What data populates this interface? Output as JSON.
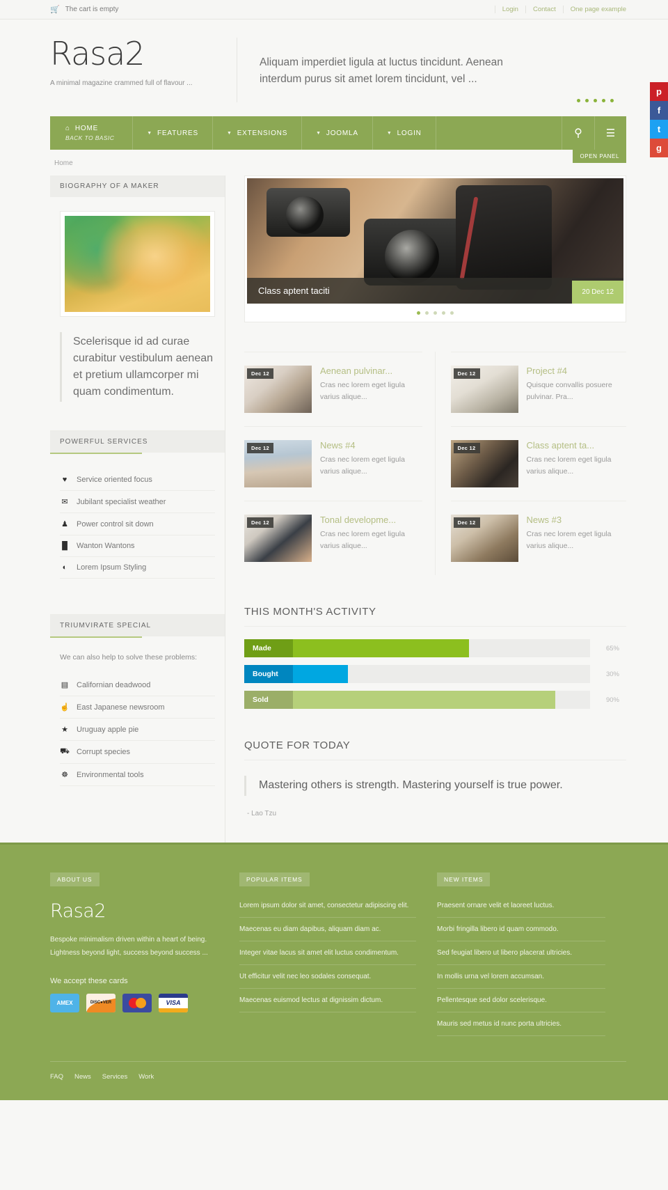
{
  "topbar": {
    "cart_icon": "cart-icon",
    "cart_text": "The cart is empty",
    "links": [
      "Login",
      "Contact",
      "One page example"
    ]
  },
  "header": {
    "brand": "Rasa2",
    "tagline": "A minimal magazine crammed full of flavour ...",
    "promo": "Aliquam imperdiet ligula at luctus tincidunt. Aenean interdum purus sit amet lorem tincidunt, vel ...",
    "promo_dots": 5
  },
  "nav": {
    "items": [
      {
        "label": "HOME",
        "sub": "BACK TO BASIC",
        "icon": "home-icon",
        "caret": false
      },
      {
        "label": "FEATURES",
        "sub": "",
        "icon": "",
        "caret": true
      },
      {
        "label": "EXTENSIONS",
        "sub": "",
        "icon": "",
        "caret": true
      },
      {
        "label": "JOOMLA",
        "sub": "",
        "icon": "",
        "caret": true
      },
      {
        "label": "LOGIN",
        "sub": "",
        "icon": "",
        "caret": true
      }
    ],
    "search_icon": "search-icon",
    "menu_icon": "hamburger-icon",
    "open_panel": "OPEN PANEL"
  },
  "breadcrumb": "Home",
  "sidebar": {
    "biography": {
      "title": "BIOGRAPHY OF A MAKER",
      "image_name": "portrait-photo",
      "quote": "Scelerisque id ad curae curabitur vestibulum aenean et pretium ullamcorper mi quam condimentum."
    },
    "services": {
      "title": "POWERFUL SERVICES",
      "items": [
        {
          "icon": "heart-icon",
          "glyph": "♥",
          "label": "Service oriented focus"
        },
        {
          "icon": "envelope-icon",
          "glyph": "✉",
          "label": "Jubilant specialist weather"
        },
        {
          "icon": "user-icon",
          "glyph": "♟",
          "label": "Power control sit down"
        },
        {
          "icon": "bar-chart-icon",
          "glyph": "█",
          "label": "Wanton Wantons"
        },
        {
          "icon": "contrast-icon",
          "glyph": "◐",
          "label": "Lorem Ipsum Styling"
        }
      ]
    },
    "triumvirate": {
      "title": "TRIUMVIRATE SPECIAL",
      "note": "We can also help to solve these problems:",
      "items": [
        {
          "icon": "film-icon",
          "glyph": "▤",
          "label": "Californian deadwood"
        },
        {
          "icon": "thumbs-up-icon",
          "glyph": "☝",
          "label": "East Japanese newsroom"
        },
        {
          "icon": "star-icon",
          "glyph": "★",
          "label": "Uruguay apple pie"
        },
        {
          "icon": "car-icon",
          "glyph": "⛟",
          "label": "Corrupt species"
        },
        {
          "icon": "globe-icon",
          "glyph": "☸",
          "label": "Environmental tools"
        }
      ]
    }
  },
  "slider": {
    "image_name": "vintage-cameras-photo",
    "caption": "Class aptent taciti",
    "date": "20 Dec 12",
    "dots": 5,
    "active_dot": 0
  },
  "articles": {
    "left": [
      {
        "badge": "Dec 12",
        "title": "Aenean pulvinar...",
        "desc": "Cras nec lorem eget ligula varius alique...",
        "thumb": "t-desk",
        "thumb_name": "desk-speaker-photo"
      },
      {
        "badge": "Dec 12",
        "title": "News #4",
        "desc": "Cras nec lorem eget ligula varius alique...",
        "thumb": "t-beach",
        "thumb_name": "beach-woman-photo"
      },
      {
        "badge": "Dec 12",
        "title": "Tonal developme...",
        "desc": "Cras nec lorem eget ligula varius alique...",
        "thumb": "t-office",
        "thumb_name": "office-desk-photo"
      }
    ],
    "right": [
      {
        "badge": "Dec 12",
        "title": "Project #4",
        "desc": "Quisque convallis posuere pulvinar. Pra...",
        "thumb": "t-kitchen",
        "thumb_name": "kitchen-shelf-photo"
      },
      {
        "badge": "Dec 12",
        "title": "Class aptent ta...",
        "desc": "Cras nec lorem eget ligula varius alique...",
        "thumb": "t-cams",
        "thumb_name": "cameras-photo"
      },
      {
        "badge": "Dec 12",
        "title": "News #3",
        "desc": "Cras nec lorem eget ligula varius alique...",
        "thumb": "t-wallet",
        "thumb_name": "wallet-photo"
      }
    ]
  },
  "activity": {
    "title": "THIS MONTH'S ACTIVITY",
    "bars": [
      {
        "label": "Made",
        "pct": "65%",
        "value": 65,
        "fill": "#8cbf1f",
        "label_bg": "#6f9e16"
      },
      {
        "label": "Bought",
        "pct": "30%",
        "value": 30,
        "fill": "#00a7e1",
        "label_bg": "#0086bf"
      },
      {
        "label": "Sold",
        "pct": "90%",
        "value": 90,
        "fill": "#b6d07a",
        "label_bg": "#9bae68"
      }
    ]
  },
  "quote_section": {
    "title": "QUOTE FOR TODAY",
    "text": "Mastering others is strength. Mastering yourself is true power.",
    "author": "- Lao Tzu"
  },
  "social": [
    {
      "name": "pinterest-icon",
      "glyph": "p",
      "cls": "s-pin"
    },
    {
      "name": "facebook-icon",
      "glyph": "f",
      "cls": "s-fb"
    },
    {
      "name": "twitter-icon",
      "glyph": "t",
      "cls": "s-tw"
    },
    {
      "name": "google-plus-icon",
      "glyph": "g",
      "cls": "s-gp"
    }
  ],
  "footer": {
    "about": {
      "badge": "ABOUT US",
      "brand": "Rasa2",
      "text": "Bespoke minimalism driven within a heart of being. Lightness beyond light, success beyond success ...",
      "cards_label": "We accept these cards",
      "cards": [
        "AMEX",
        "DISCOVER",
        "MASTERCARD",
        "VISA"
      ]
    },
    "popular": {
      "badge": "POPULAR ITEMS",
      "items": [
        "Lorem ipsum dolor sit amet, consectetur adipiscing elit.",
        "Maecenas eu diam dapibus, aliquam diam ac.",
        "Integer vitae lacus sit amet elit luctus condimentum.",
        "Ut efficitur velit nec leo sodales consequat.",
        "Maecenas euismod lectus at dignissim dictum."
      ]
    },
    "newitems": {
      "badge": "NEW ITEMS",
      "items": [
        "Praesent ornare velit et laoreet luctus.",
        "Morbi fringilla libero id quam commodo.",
        "Sed feugiat libero ut libero placerat ultricies.",
        "In mollis urna vel lorem accumsan.",
        "Pellentesque sed dolor scelerisque.",
        "Mauris sed metus id nunc porta ultricies."
      ]
    },
    "bottom_links": [
      "FAQ",
      "News",
      "Services",
      "Work"
    ]
  }
}
